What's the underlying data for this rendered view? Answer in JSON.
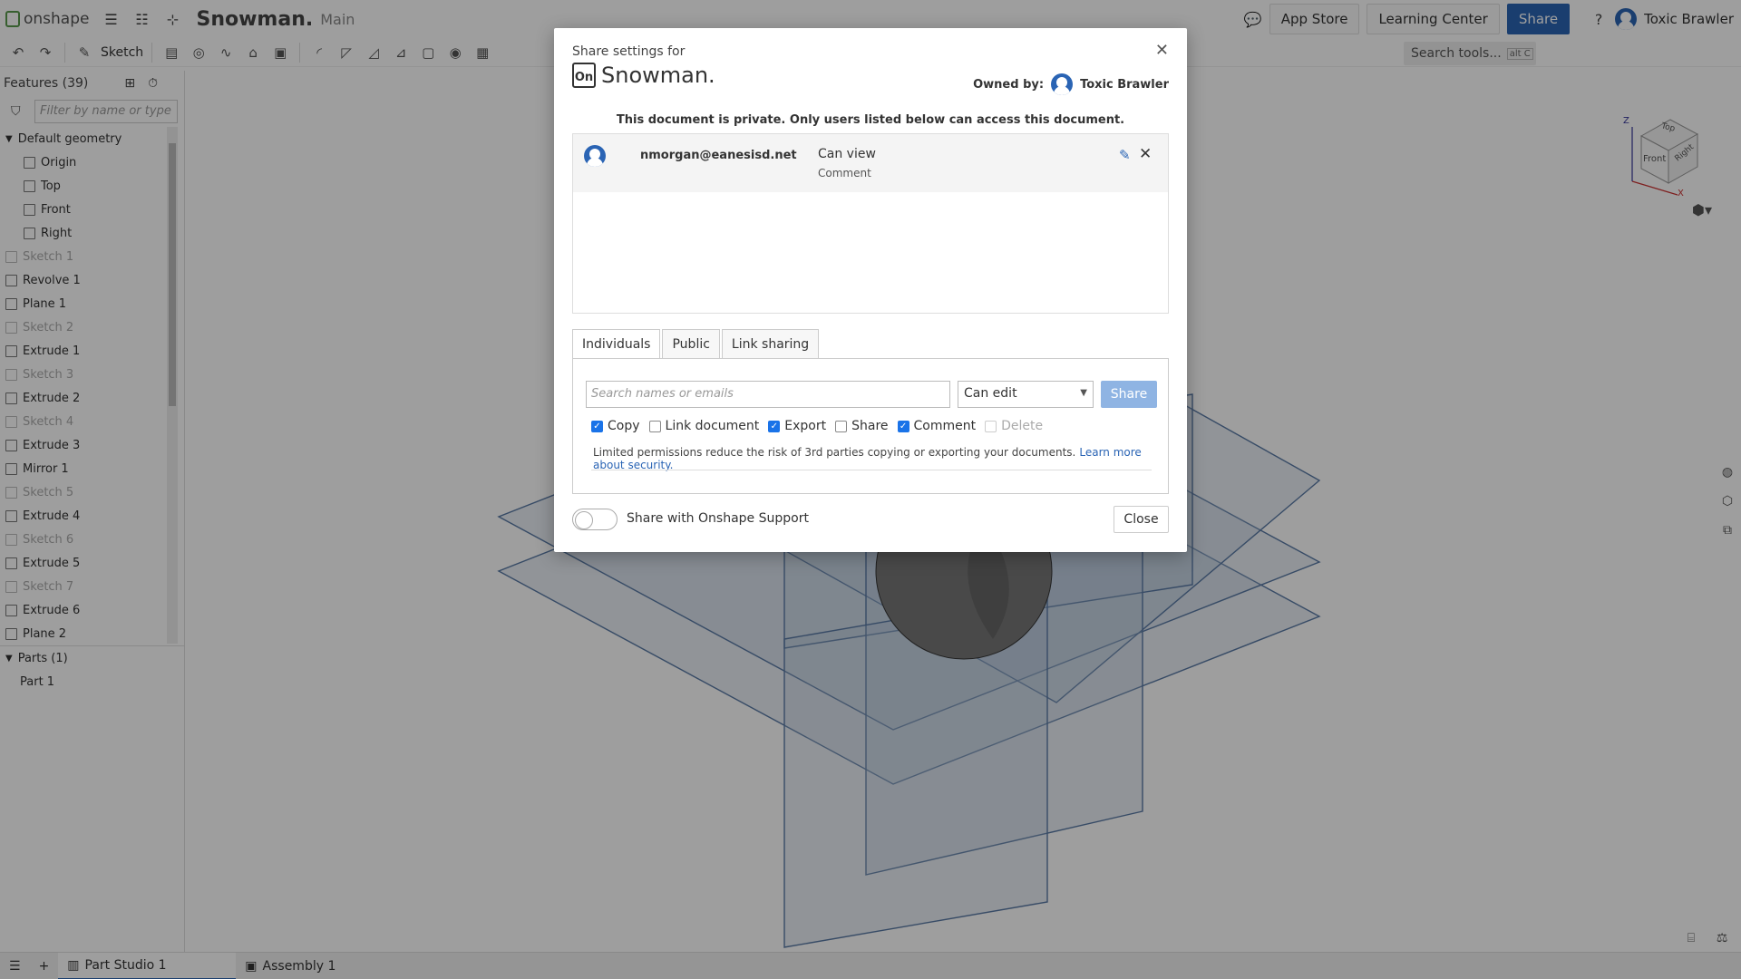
{
  "app": {
    "name": "onshape",
    "doc_title": "Snowman.",
    "branch": "Main"
  },
  "topbar": {
    "app_store": "App Store",
    "learning_center": "Learning Center",
    "share": "Share",
    "user": "Toxic Brawler",
    "help": "?"
  },
  "toolbar": {
    "sketch": "Sketch",
    "search_tools": "Search tools...",
    "search_kbd": "alt C"
  },
  "features": {
    "title": "Features (39)",
    "filter_placeholder": "Filter by name or type",
    "items": [
      {
        "label": "Default geometry",
        "dim": false
      },
      {
        "label": "Origin",
        "dim": false
      },
      {
        "label": "Top",
        "dim": false
      },
      {
        "label": "Front",
        "dim": false
      },
      {
        "label": "Right",
        "dim": false
      },
      {
        "label": "Sketch 1",
        "dim": true
      },
      {
        "label": "Revolve 1",
        "dim": false
      },
      {
        "label": "Plane 1",
        "dim": false
      },
      {
        "label": "Sketch 2",
        "dim": true
      },
      {
        "label": "Extrude 1",
        "dim": false
      },
      {
        "label": "Sketch 3",
        "dim": true
      },
      {
        "label": "Extrude 2",
        "dim": false
      },
      {
        "label": "Sketch 4",
        "dim": true
      },
      {
        "label": "Extrude 3",
        "dim": false
      },
      {
        "label": "Mirror 1",
        "dim": false
      },
      {
        "label": "Sketch 5",
        "dim": true
      },
      {
        "label": "Extrude 4",
        "dim": false
      },
      {
        "label": "Sketch 6",
        "dim": true
      },
      {
        "label": "Extrude 5",
        "dim": false
      },
      {
        "label": "Sketch 7",
        "dim": true
      },
      {
        "label": "Extrude 6",
        "dim": false
      },
      {
        "label": "Plane 2",
        "dim": false
      }
    ],
    "parts_title": "Parts (1)",
    "parts": [
      "Part 1"
    ]
  },
  "bottom_tabs": [
    "Part Studio 1",
    "Assembly 1"
  ],
  "viewcube": {
    "top": "Top",
    "front": "Front",
    "right": "Right",
    "z": "Z",
    "x": "X"
  },
  "dialog": {
    "share_for": "Share settings for",
    "title": "Snowman.",
    "owned_by_label": "Owned by:",
    "owner": "Toxic Brawler",
    "private_note": "This document is private. Only users listed below can access this document.",
    "users": [
      {
        "email": "nmorgan@eanesisd.net",
        "permission": "Can view",
        "sub": "Comment"
      }
    ],
    "tabs": [
      "Individuals",
      "Public",
      "Link sharing"
    ],
    "search_placeholder": "Search names or emails",
    "perm_select": "Can edit",
    "share_btn": "Share",
    "checks": [
      {
        "label": "Copy",
        "checked": true,
        "disabled": false
      },
      {
        "label": "Link document",
        "checked": false,
        "disabled": false
      },
      {
        "label": "Export",
        "checked": true,
        "disabled": false
      },
      {
        "label": "Share",
        "checked": false,
        "disabled": false
      },
      {
        "label": "Comment",
        "checked": true,
        "disabled": false
      },
      {
        "label": "Delete",
        "checked": false,
        "disabled": true
      }
    ],
    "limited_note": "Limited permissions reduce the risk of 3rd parties copying or exporting your documents.",
    "learn_more": "Learn more about security.",
    "support_label": "Share with Onshape Support",
    "close_btn": "Close"
  }
}
